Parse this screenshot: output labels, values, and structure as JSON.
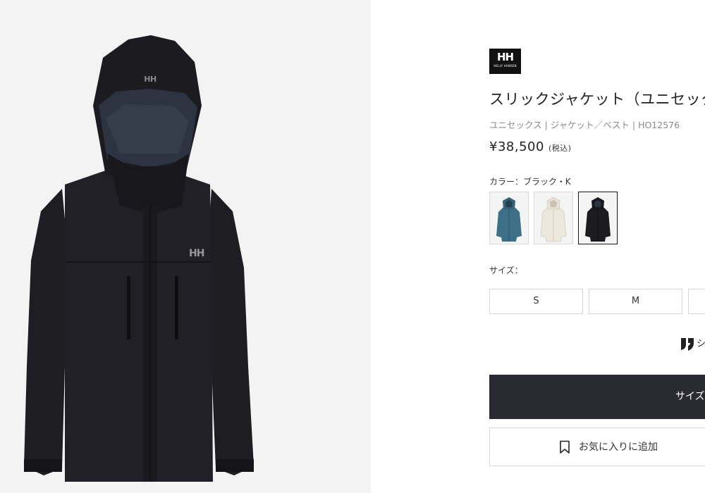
{
  "gallery": {
    "main_image": "black-hooded-shell-jacket",
    "logo_text": "HH"
  },
  "brand": {
    "logo_mark": "HH",
    "logo_sub": "HELLY HANSEN"
  },
  "product": {
    "title": "スリックジャケット（ユニセック",
    "meta": "ユニセックス | ジャケット／ベスト | HO12576",
    "price": "¥38,500",
    "tax_note": "(税込)"
  },
  "color": {
    "label": "カラー：ブラック・K",
    "swatches": [
      {
        "name": "blue",
        "hex": "#3d6f86",
        "selected": false
      },
      {
        "name": "white",
        "hex": "#ece8dc",
        "selected": false
      },
      {
        "name": "black",
        "hex": "#1b1b20",
        "selected": true
      }
    ]
  },
  "size": {
    "label": "サイズ：",
    "options": [
      "S",
      "M",
      ""
    ]
  },
  "share": {
    "icon": "share-icon",
    "label": "シ"
  },
  "cart_button": {
    "label": "サイズ"
  },
  "favorite_button": {
    "icon": "bookmark-icon",
    "label": "お気に入りに追加"
  },
  "colors": {
    "cart_bg": "#2a2a33",
    "gallery_bg": "#f3f3f3",
    "text": "#222222",
    "muted": "#8a8a8a"
  }
}
